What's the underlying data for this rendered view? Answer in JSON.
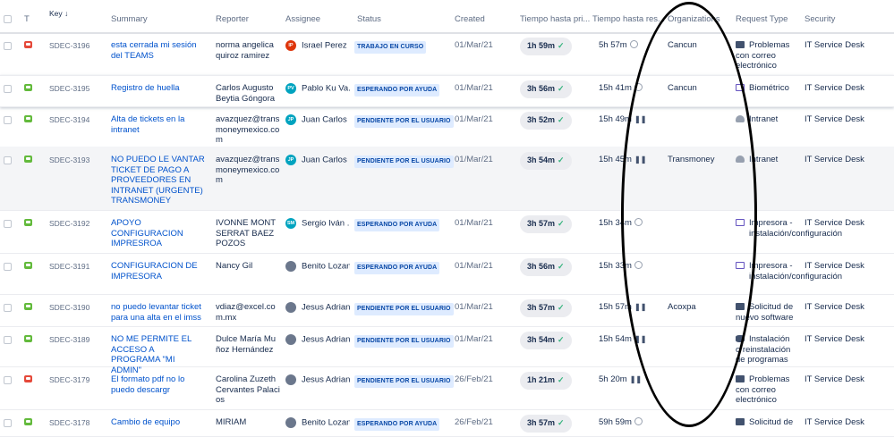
{
  "columns": {
    "type": "T",
    "key": "Key",
    "key_sort": "↓",
    "summary": "Summary",
    "reporter": "Reporter",
    "assignee": "Assignee",
    "status": "Status",
    "created": "Created",
    "sla1": "Tiempo hasta pri...",
    "sla2": "Tiempo hasta res...",
    "organizations": "Organizations",
    "request_type": "Request Type",
    "security": "Security"
  },
  "colors": {
    "accent": "#0052cc",
    "incident": "#e5493a",
    "request": "#63ba3c",
    "status_bg": "#deebff",
    "sla_ok": "#36b37e"
  },
  "rows": [
    {
      "type": "incident",
      "key": "SDEC-3196",
      "summary": "esta cerrada mi sesión del TEAMS",
      "reporter": "norma angelica quiroz ramirez",
      "assignee_initials": "IP",
      "assignee_color": "#de350b",
      "assignee": "Israel Perez",
      "status": "TRABAJO EN CURSO",
      "created": "01/Mar/21",
      "sla1": "1h 59m",
      "sla2": "5h 57m",
      "sla2_icon": "clock",
      "organization": "Cancun",
      "request_type": "Problemas con correo electrónico",
      "rt_icon": "mail",
      "security": "IT Service Desk"
    },
    {
      "type": "request",
      "key": "SDEC-3195",
      "summary": "Registro de huella",
      "reporter": "Carlos Augusto Beytia Góngora",
      "assignee_initials": "PV",
      "assignee_color": "#00a3bf",
      "assignee": "Pablo Ku Va...",
      "status": "ESPERANDO POR AYUDA",
      "created": "01/Mar/21",
      "sla1": "3h 56m",
      "sla2": "15h 41m",
      "sla2_icon": "clock",
      "organization": "Cancun",
      "request_type": "Biométrico",
      "rt_icon": "monitor",
      "security": "IT Service Desk"
    },
    {
      "type": "request",
      "key": "SDEC-3194",
      "summary": "Alta de tickets en la intranet",
      "reporter": "avazquez@transmoneymexico.com",
      "assignee_initials": "JP",
      "assignee_color": "#00a3bf",
      "assignee": "Juan Carlos ...",
      "status": "PENDIENTE POR EL USUARIO",
      "created": "01/Mar/21",
      "sla1": "3h 52m",
      "sla2": "15h 49m",
      "sla2_icon": "pause",
      "organization": "",
      "request_type": "Intranet",
      "rt_icon": "cloud",
      "security": "IT Service Desk"
    },
    {
      "type": "request",
      "key": "SDEC-3193",
      "summary": "NO PUEDO LE VANTAR TICKET DE PAGO A PROVEEDORES EN INTRANET (URGENTE) TRANSMONEY",
      "reporter": "avazquez@transmoneymexico.com",
      "assignee_initials": "JP",
      "assignee_color": "#00a3bf",
      "assignee": "Juan Carlos ...",
      "status": "PENDIENTE POR EL USUARIO",
      "created": "01/Mar/21",
      "sla1": "3h 54m",
      "sla2": "15h 45m",
      "sla2_icon": "pause",
      "organization": "Transmoney",
      "request_type": "Intranet",
      "rt_icon": "cloud",
      "security": "IT Service Desk"
    },
    {
      "type": "request",
      "key": "SDEC-3192",
      "summary": "APOYO CONFIGURACION IMPRESROA",
      "reporter": "IVONNE MONTSERRAT BAEZ POZOS",
      "assignee_initials": "SM",
      "assignee_color": "#00a3bf",
      "assignee": "Sergio Iván ...",
      "status": "ESPERANDO POR AYUDA",
      "created": "01/Mar/21",
      "sla1": "3h 57m",
      "sla2": "15h 34m",
      "sla2_icon": "clock",
      "organization": "",
      "request_type": "Impresora - instalación/configuración",
      "rt_icon": "monitor",
      "security": "IT Service Desk"
    },
    {
      "type": "request",
      "key": "SDEC-3191",
      "summary": "CONFIGURACION DE IMPRESORA",
      "reporter": "Nancy Gil",
      "assignee_initials": "",
      "assignee_color": "#6b778c",
      "assignee": "Benito Lozano",
      "status": "ESPERANDO POR AYUDA",
      "created": "01/Mar/21",
      "sla1": "3h 56m",
      "sla2": "15h 33m",
      "sla2_icon": "clock",
      "organization": "",
      "request_type": "Impresora - instalación/configuración",
      "rt_icon": "monitor",
      "security": "IT Service Desk"
    },
    {
      "type": "request",
      "key": "SDEC-3190",
      "summary": "no puedo levantar ticket para una alta en el imss",
      "reporter": "vdiaz@excel.com.mx",
      "assignee_initials": "",
      "assignee_color": "#6b778c",
      "assignee": "Jesus Adrian...",
      "status": "PENDIENTE POR EL USUARIO",
      "created": "01/Mar/21",
      "sla1": "3h 57m",
      "sla2": "15h 57m",
      "sla2_icon": "pause",
      "organization": "Acoxpa",
      "request_type": "Solicitud de nuevo software",
      "rt_icon": "mail",
      "security": "IT Service Desk"
    },
    {
      "type": "request",
      "key": "SDEC-3189",
      "summary": "NO ME PERMITE EL ACCESO A PROGRAMA \"MI ADMIN\"",
      "reporter": "Dulce María Muñoz Hernández",
      "assignee_initials": "",
      "assignee_color": "#6b778c",
      "assignee": "Jesus Adrian...",
      "status": "PENDIENTE POR EL USUARIO",
      "created": "01/Mar/21",
      "sla1": "3h 54m",
      "sla2": "15h 54m",
      "sla2_icon": "pause",
      "organization": "",
      "request_type": "Instalación o reinstalación de programas",
      "rt_icon": "db",
      "security": "IT Service Desk"
    },
    {
      "type": "incident",
      "key": "SDEC-3179",
      "summary": "El formato pdf no lo puedo descargr",
      "reporter": "Carolina Zuzeth Cervantes Palacios",
      "assignee_initials": "",
      "assignee_color": "#6b778c",
      "assignee": "Jesus Adrian...",
      "status": "PENDIENTE POR EL USUARIO",
      "created": "26/Feb/21",
      "sla1": "1h 21m",
      "sla2": "5h 20m",
      "sla2_icon": "pause",
      "organization": "",
      "request_type": "Problemas con correo electrónico",
      "rt_icon": "mail",
      "security": "IT Service Desk"
    },
    {
      "type": "request",
      "key": "SDEC-3178",
      "summary": "Cambio de equipo",
      "reporter": "MIRIAM",
      "assignee_initials": "",
      "assignee_color": "#6b778c",
      "assignee": "Benito Lozano",
      "status": "ESPERANDO POR AYUDA",
      "created": "26/Feb/21",
      "sla1": "3h 57m",
      "sla2": "59h 59m",
      "sla2_icon": "clock",
      "organization": "",
      "request_type": "Solicitud de",
      "rt_icon": "mail",
      "security": "IT Service Desk"
    }
  ]
}
